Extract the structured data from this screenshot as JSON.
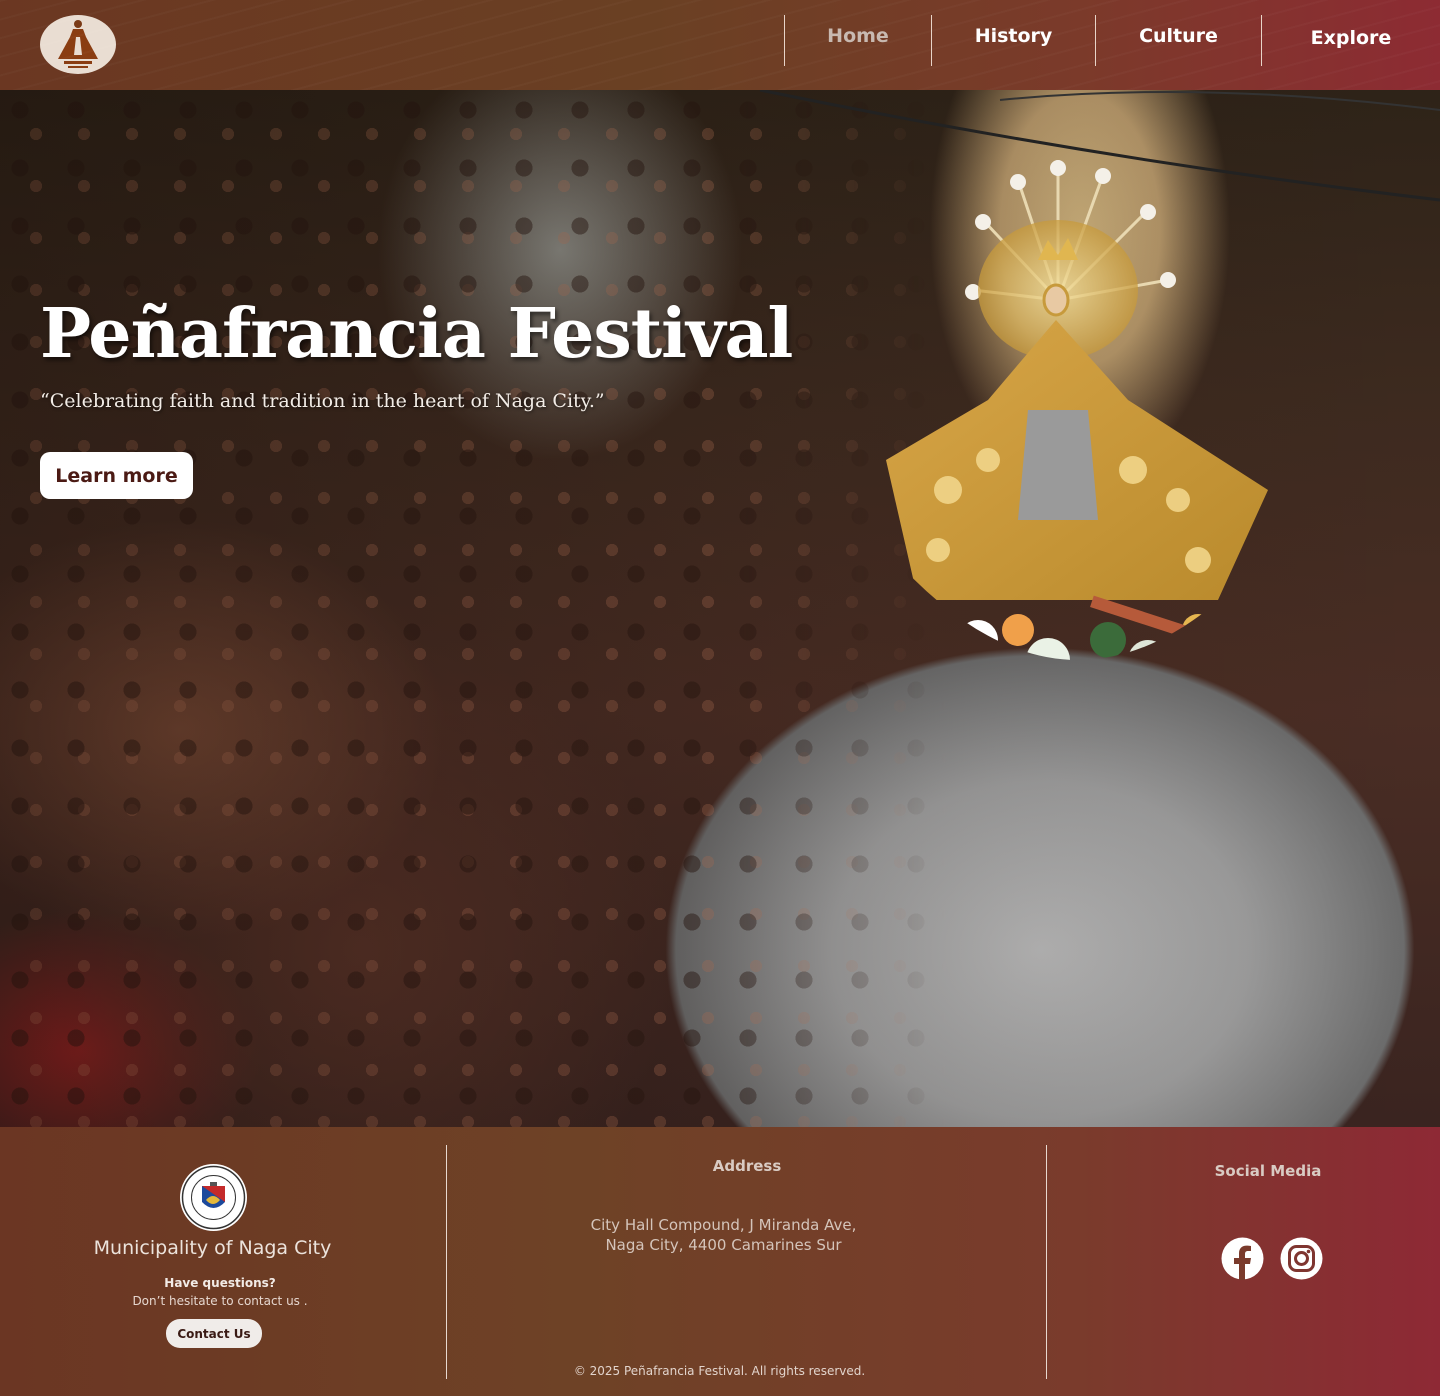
{
  "nav": {
    "home": "Home",
    "history": "History",
    "culture": "Culture",
    "explore": "Explore",
    "active": "Home"
  },
  "hero": {
    "title": "Peñafrancia Festival",
    "subtitle": "“Celebrating faith and tradition in the heart of Naga City.”",
    "cta_label": "Learn more"
  },
  "footer": {
    "municipality": "Municipality of Naga City",
    "questions": "Have questions?",
    "contact_text": "Don’t hesitate to contact us .",
    "contact_button": "Contact Us",
    "address_heading": "Address",
    "address_line1": "City Hall Compound, J Miranda Ave,",
    "address_line2": "Naga City, 4400 Camarines Sur",
    "copyright": "© 2025 Peñafrancia Festival. All rights reserved.",
    "social_heading": "Social Media",
    "social_icons": [
      "facebook-icon",
      "instagram-icon"
    ]
  },
  "colors": {
    "header_gradient_start": "#6b3722",
    "header_gradient_end": "#8d2b33",
    "button_text": "#4b1a14",
    "nav_active": "#c8b9b0"
  }
}
